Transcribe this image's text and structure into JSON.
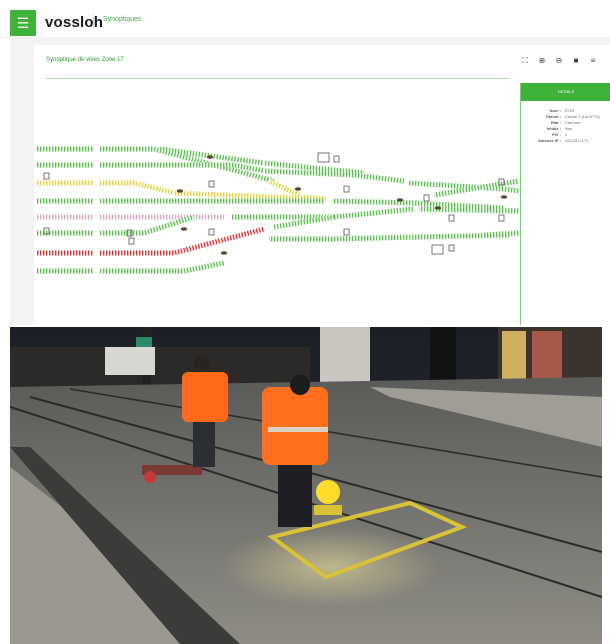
{
  "header": {
    "menu_icon": "menu-icon",
    "logo_text": "vossloh",
    "app_title": "Synoptiques"
  },
  "panel": {
    "title": "Synoptique de voies Zone 17",
    "tools": [
      "expand-icon",
      "zoom-in-icon",
      "zoom-out-icon",
      "comment-icon",
      "list-icon"
    ]
  },
  "details": {
    "header": "DETAILS",
    "rows": [
      {
        "key": "Nom :",
        "value": "E722"
      },
      {
        "key": "Parent :",
        "value": "Centre 1 (Lis 2F7A)"
      },
      {
        "key": "Etat :",
        "value": "Cdd bon"
      },
      {
        "key": "Inhibé :",
        "value": "Non"
      },
      {
        "key": "PIV :",
        "value": "0"
      },
      {
        "key": "Adresse IP :",
        "value": "192.16.0.171"
      }
    ]
  },
  "colors": {
    "brand_green": "#3fb23a",
    "track_green": "#5cbf4f",
    "track_yellow": "#e8d23c",
    "track_red": "#d6343a",
    "track_pink": "#d9a8c2"
  },
  "photo": {
    "subject": "photograph"
  }
}
